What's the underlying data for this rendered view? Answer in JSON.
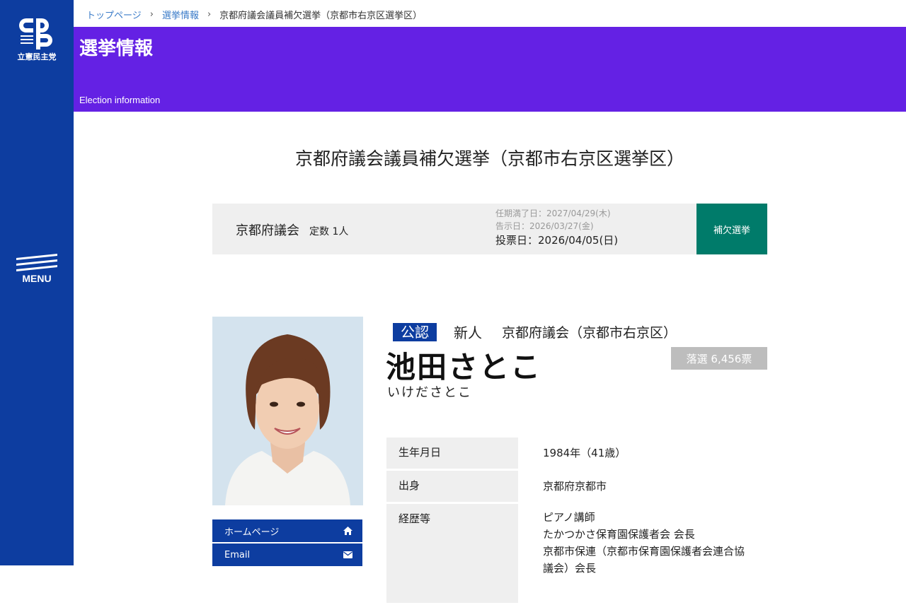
{
  "sidebar": {
    "party_name": "立憲民主党",
    "logo_text": "CDP",
    "menu_label": "MENU"
  },
  "breadcrumb": {
    "home": "トップページ",
    "section": "選挙情報",
    "current": "京都府議会議員補欠選挙（京都市右京区選挙区）"
  },
  "banner": {
    "title": "選挙情報",
    "subtitle": "Election information"
  },
  "election": {
    "title": "京都府議会議員補欠選挙（京都市右京区選挙区）",
    "assembly": "京都府議会",
    "seats": "定数 1人",
    "term_end": "任期満了日：2027/04/29(木)",
    "notice_date": "告示日：2026/03/27(金)",
    "vote_date": "投票日：2026/04/05(日)",
    "type": "補欠選挙"
  },
  "candidate": {
    "endorsement": "公認",
    "status": "新人",
    "district": "京都府議会（京都市右京区）",
    "name": "池田さとこ",
    "kana": "いけださとこ",
    "result": "落選 6,456票",
    "profile": [
      {
        "key": "生年月日",
        "value": "1984年（41歳）"
      },
      {
        "key": "出身",
        "value": "京都府京都市"
      },
      {
        "key": "経歴等",
        "lines": [
          "ピアノ講師",
          "たかつかさ保育園保護者会 会長",
          "京都市保連（京都市保育園保護者会連合協",
          "議会）会長"
        ]
      }
    ]
  },
  "links": {
    "homepage": "ホームページ",
    "email": "Email"
  },
  "colors": {
    "sidebar": "#0d3da0",
    "banner": "#6421e4",
    "type_badge": "#007b6a",
    "result_badge": "#bdbdbd"
  },
  "icons": {
    "homepage": "home-icon",
    "email": "envelope-icon"
  }
}
